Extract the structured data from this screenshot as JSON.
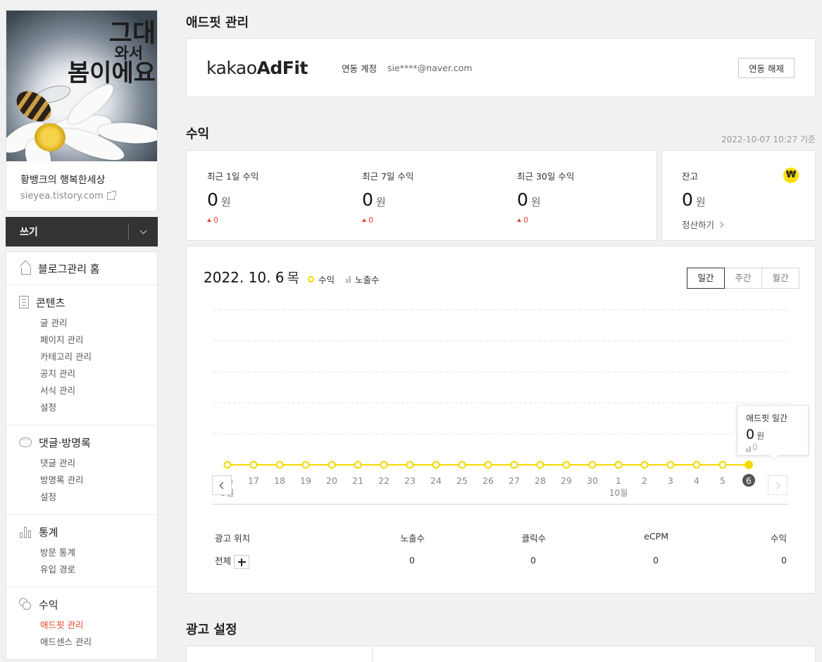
{
  "blog": {
    "name": "황뱅크의 행복한세상",
    "url": "sieyea.tistory.com",
    "cover_text": [
      "그대",
      "와서",
      "봄이에요"
    ]
  },
  "write": {
    "label": "쓰기"
  },
  "menu": [
    {
      "key": "home",
      "icon": "home-icon",
      "title": "블로그관리 홈",
      "items": []
    },
    {
      "key": "contents",
      "icon": "document-icon",
      "title": "콘텐츠",
      "items": [
        "글 관리",
        "페이지 관리",
        "카테고리 관리",
        "공지 관리",
        "서식 관리",
        "설정"
      ]
    },
    {
      "key": "comments",
      "icon": "comment-icon",
      "title": "댓글·방명록",
      "items": [
        "댓글 관리",
        "방명록 관리",
        "설정"
      ]
    },
    {
      "key": "stats",
      "icon": "bar-chart-icon",
      "title": "통계",
      "items": [
        "방문 통계",
        "유입 경로"
      ]
    },
    {
      "key": "revenue",
      "icon": "coins-icon",
      "title": "수익",
      "items": [
        "애드핏 관리",
        "애드센스 관리"
      ],
      "active_item": "애드핏 관리"
    }
  ],
  "adfit": {
    "title": "애드핏 관리",
    "logo_plain": "kakao",
    "logo_bold": "AdFit",
    "link_label": "연동 계정",
    "link_account": "sie****@naver.com",
    "unlink_button": "연동 해제"
  },
  "revenue": {
    "title": "수익",
    "as_of": "2022-10-07 10:27 기준",
    "stats": [
      {
        "label": "최근 1일 수익",
        "value": "0",
        "unit": "원",
        "delta": "0"
      },
      {
        "label": "최근 7일 수익",
        "value": "0",
        "unit": "원",
        "delta": "0"
      },
      {
        "label": "최근 30일 수익",
        "value": "0",
        "unit": "원",
        "delta": "0"
      }
    ],
    "balance": {
      "label": "잔고",
      "value": "0",
      "unit": "원",
      "settle": "정산하기",
      "currency_icon": "₩"
    }
  },
  "chart": {
    "date": "2022. 10. 6",
    "day_of_week": "목",
    "legend_revenue": "수익",
    "legend_impressions": "노출수",
    "tabs": [
      "일간",
      "주간",
      "월간"
    ],
    "active_tab": "일간",
    "tooltip": {
      "title": "애드핏 일간",
      "value": "0",
      "unit": "원",
      "impressions": "0"
    }
  },
  "chart_data": {
    "type": "line",
    "x": [
      "16",
      "17",
      "18",
      "19",
      "20",
      "21",
      "22",
      "23",
      "24",
      "25",
      "26",
      "27",
      "28",
      "29",
      "30",
      "1",
      "2",
      "3",
      "4",
      "5",
      "6"
    ],
    "month_labels": [
      {
        "at": "16",
        "label": "9월"
      },
      {
        "at": "1",
        "label": "10월"
      }
    ],
    "series": [
      {
        "name": "수익",
        "values": [
          0,
          0,
          0,
          0,
          0,
          0,
          0,
          0,
          0,
          0,
          0,
          0,
          0,
          0,
          0,
          0,
          0,
          0,
          0,
          0,
          0
        ]
      }
    ],
    "selected": "6",
    "grid": true,
    "colors": {
      "line": "#f3d900",
      "selected_label_bg": "#555555"
    }
  },
  "table": {
    "headers": [
      "광고 위치",
      "노출수",
      "클릭수",
      "eCPM",
      "수익"
    ],
    "rows": [
      {
        "position": "전체",
        "impressions": "0",
        "clicks": "0",
        "ecpm": "0",
        "revenue": "0"
      }
    ]
  },
  "ad_settings": {
    "title": "광고 설정"
  },
  "colors": {
    "accent": "#e8472b",
    "adfit_yellow": "#ffe000",
    "dark_bar": "#333333"
  }
}
